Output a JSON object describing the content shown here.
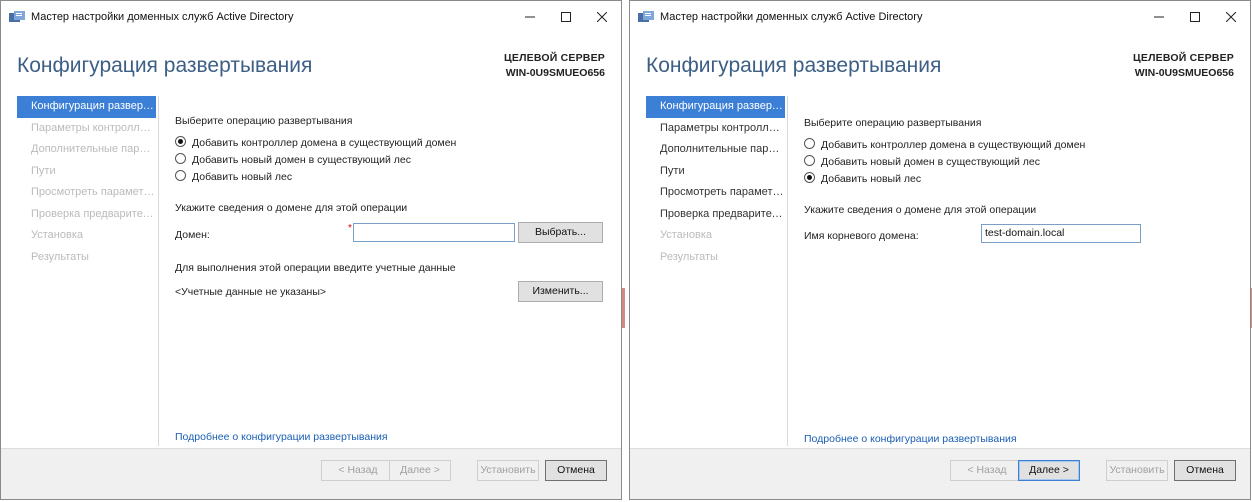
{
  "windows": [
    {
      "title": "Мастер настройки доменных служб Active Directory",
      "page_title": "Конфигурация развертывания",
      "target_server_label": "ЦЕЛЕВОЙ СЕРВЕР",
      "target_server_name": "WIN-0U9SMUEO656",
      "nav": [
        {
          "label": "Конфигурация развертывания",
          "state": "selected"
        },
        {
          "label": "Параметры контроллера домена",
          "state": "disabled"
        },
        {
          "label": "Дополнительные параметры",
          "state": "disabled"
        },
        {
          "label": "Пути",
          "state": "disabled"
        },
        {
          "label": "Просмотреть параметры",
          "state": "disabled"
        },
        {
          "label": "Проверка предварительных требований",
          "state": "disabled"
        },
        {
          "label": "Установка",
          "state": "disabled"
        },
        {
          "label": "Результаты",
          "state": "disabled"
        }
      ],
      "operation_label": "Выберите операцию развертывания",
      "options": [
        {
          "label": "Добавить контроллер домена в существующий домен",
          "selected": true
        },
        {
          "label": "Добавить новый домен в существующий лес",
          "selected": false
        },
        {
          "label": "Добавить новый лес",
          "selected": false
        }
      ],
      "domain_section_label": "Укажите сведения о домене для этой операции",
      "domain_field_label": "Домен:",
      "domain_value": "",
      "required_mark": "*",
      "select_button": "Выбрать...",
      "credentials_label": "Для выполнения этой операции введите учетные данные",
      "credentials_value": "<Учетные данные не указаны>",
      "change_button": "Изменить...",
      "more_link": "Подробнее о конфигурации развертывания",
      "footer": {
        "back": "< Назад",
        "next": "Далее >",
        "install": "Установить",
        "cancel": "Отмена"
      },
      "next_enabled": false
    },
    {
      "title": "Мастер настройки доменных служб Active Directory",
      "page_title": "Конфигурация развертывания",
      "target_server_label": "ЦЕЛЕВОЙ СЕРВЕР",
      "target_server_name": "WIN-0U9SMUEO656",
      "nav": [
        {
          "label": "Конфигурация развертывания",
          "state": "selected"
        },
        {
          "label": "Параметры контроллера домена",
          "state": "normal"
        },
        {
          "label": "Дополнительные параметры",
          "state": "normal"
        },
        {
          "label": "Пути",
          "state": "normal"
        },
        {
          "label": "Просмотреть параметры",
          "state": "normal"
        },
        {
          "label": "Проверка предварительных требований",
          "state": "normal"
        },
        {
          "label": "Установка",
          "state": "disabled"
        },
        {
          "label": "Результаты",
          "state": "disabled"
        }
      ],
      "operation_label": "Выберите операцию развертывания",
      "options": [
        {
          "label": "Добавить контроллер домена в существующий домен",
          "selected": false
        },
        {
          "label": "Добавить новый домен в существующий лес",
          "selected": false
        },
        {
          "label": "Добавить новый лес",
          "selected": true
        }
      ],
      "domain_section_label": "Укажите сведения о домене для этой операции",
      "root_domain_label": "Имя корневого домена:",
      "root_domain_value": "test-domain.local",
      "more_link": "Подробнее о конфигурации развертывания",
      "footer": {
        "back": "< Назад",
        "next": "Далее >",
        "install": "Установить",
        "cancel": "Отмена"
      },
      "next_enabled": true
    }
  ]
}
